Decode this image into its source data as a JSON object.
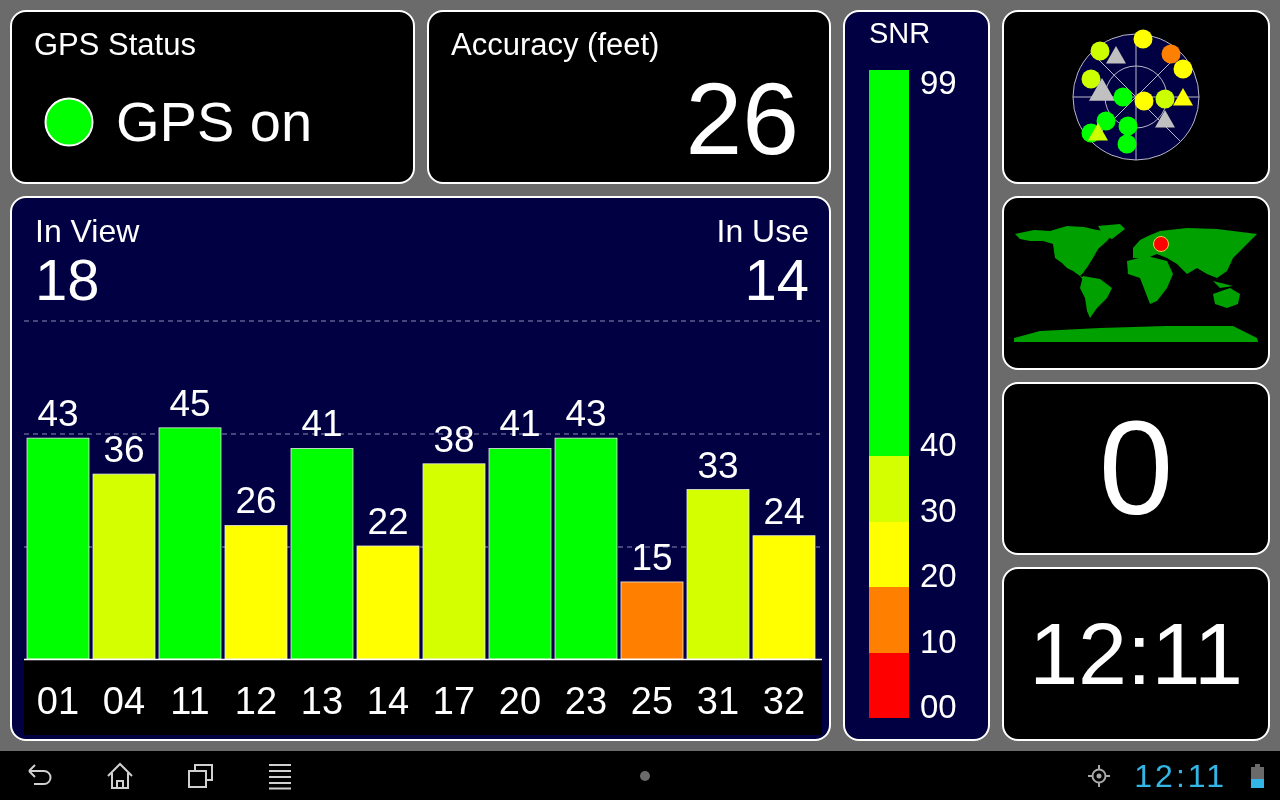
{
  "gps_status": {
    "title": "GPS Status",
    "on": true,
    "label": "GPS on"
  },
  "accuracy": {
    "title": "Accuracy (feet)",
    "value": "26"
  },
  "satellites": {
    "in_view": {
      "label": "In View",
      "value": "18"
    },
    "in_use": {
      "label": "In Use",
      "value": "14"
    },
    "chart_data": {
      "type": "bar",
      "categories": [
        "01",
        "04",
        "11",
        "12",
        "13",
        "14",
        "17",
        "20",
        "23",
        "25",
        "31",
        "32"
      ],
      "series": [
        {
          "values": [
            43,
            36,
            45,
            26,
            41,
            22,
            38,
            41,
            43,
            15,
            33,
            24
          ],
          "colors": [
            "#00ff00",
            "#d4ff00",
            "#00ff00",
            "#ffff00",
            "#00ff00",
            "#ffff00",
            "#d4ff00",
            "#00ff00",
            "#00ff00",
            "#ff8000",
            "#d4ff00",
            "#ffff00"
          ]
        }
      ],
      "data_labels": true
    }
  },
  "snr_scale": {
    "title": "SNR",
    "top_label": "99",
    "segments": [
      {
        "label": "40",
        "color": "#00ff00"
      },
      {
        "label": "30",
        "color": "#d4ff00"
      },
      {
        "label": "20",
        "color": "#ffff00"
      },
      {
        "label": "10",
        "color": "#ff8000"
      },
      {
        "label": "00",
        "color": "#ff0000"
      }
    ]
  },
  "counter": {
    "value": "0"
  },
  "clock": {
    "value": "12:11"
  },
  "status_bar": {
    "time": "12:11"
  }
}
